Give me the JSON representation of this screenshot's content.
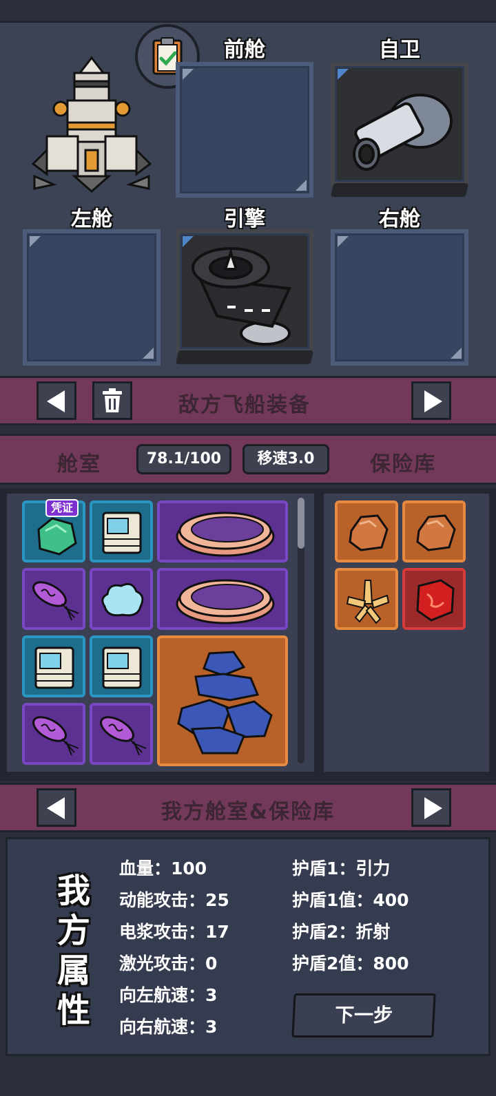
{
  "ship_slots": {
    "front": {
      "label": "前舱"
    },
    "defense": {
      "label": "自卫"
    },
    "left": {
      "label": "左舱"
    },
    "engine": {
      "label": "引擎"
    },
    "right": {
      "label": "右舱"
    }
  },
  "enemy_banner": {
    "title": "敌方飞船装备"
  },
  "tabs": {
    "cabin_label": "舱室",
    "capacity": "78.1/100",
    "speed": "移速3.0",
    "vault_label": "保险库"
  },
  "inventory": {
    "voucher_badge": "凭证"
  },
  "own_banner": {
    "title": "我方舱室&保险库"
  },
  "stats": {
    "title": "我方属性",
    "left": [
      "血量：100",
      "动能攻击：25",
      "电浆攻击：17",
      "激光攻击：0",
      "向左航速：3",
      "向右航速：3"
    ],
    "right": [
      "护盾1：引力",
      "护盾1值：400",
      "护盾2：折射",
      "护盾2值：800"
    ],
    "next_label": "下一步"
  },
  "colors": {
    "banner": "#73395a",
    "rarity_blue": "#1f6d8d",
    "rarity_purple": "#5c3192",
    "rarity_orange": "#b8622a",
    "rarity_red": "#9d2a2a"
  }
}
